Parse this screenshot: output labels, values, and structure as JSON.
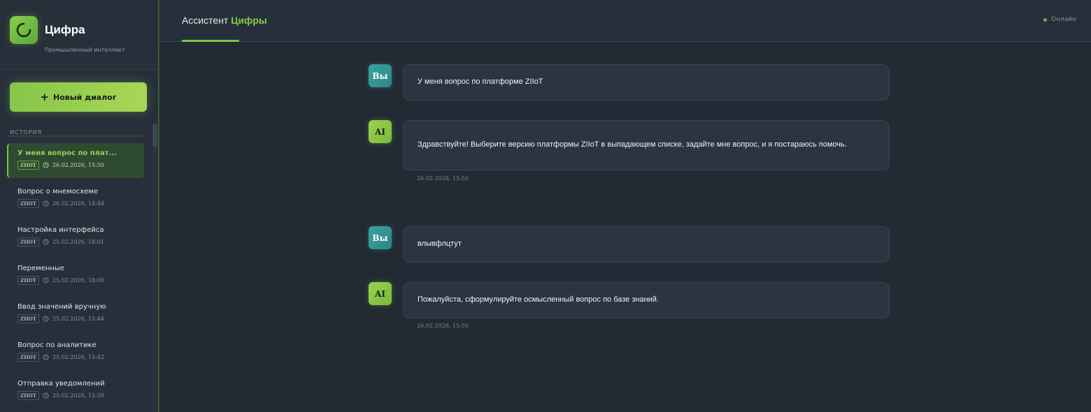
{
  "brand": {
    "name": "Цифра",
    "subtitle": "Промышленный интеллект"
  },
  "sidebar": {
    "new_dialog_label": "Новый диалог",
    "history_label": "История",
    "items": [
      {
        "title": "У меня вопрос по плат...",
        "badge": "ZIIOT",
        "date": "26.02.2026, 15:50",
        "active": true
      },
      {
        "title": "Вопрос о мнемосхеме",
        "badge": "ZIIOT",
        "date": "26.02.2026, 14:44"
      },
      {
        "title": "Настройка интерфейса",
        "badge": "ZIIOT",
        "date": "25.02.2026, 18:01"
      },
      {
        "title": "Переменные",
        "badge": "ZIIOT",
        "date": "25.02.2026, 18:00"
      },
      {
        "title": "Ввод значений вручную",
        "badge": "ZIIOT",
        "date": "25.02.2026, 15:44"
      },
      {
        "title": "Вопрос по аналитике",
        "badge": "ZIIOT",
        "date": "25.02.2026, 15:42"
      },
      {
        "title": "Отправка уведомлений",
        "badge": "ZIIOT",
        "date": "25.02.2026, 15:39"
      }
    ]
  },
  "header": {
    "title_prefix": "Ассистент",
    "title_accent": "Цифры",
    "status": "Онлайн"
  },
  "messages": [
    {
      "role": "user",
      "avatar": "Вы",
      "text": "У меня вопрос по платформе ZIIoT"
    },
    {
      "role": "ai",
      "avatar": "AI",
      "text": "Здравствуйте! Выберите версию платформы ZIIoT в выпадающем списке, задайте мне вопрос, и я постараюсь помочь.",
      "time": "26.02.2026, 15:50"
    },
    {
      "role": "user",
      "avatar": "Вы",
      "text": "влывфлцтут"
    },
    {
      "role": "ai",
      "avatar": "AI",
      "text": "Пожалуйста, сформулируйте осмысленный вопрос по базе знаний.",
      "time": "26.02.2026, 15:50"
    }
  ],
  "colors": {
    "accent": "#7cc24a",
    "user_avatar": "#3aa3a0",
    "background": "#222a33",
    "sidebar": "#27303a"
  },
  "icons": {
    "logo": "cifra-logo-icon",
    "plus": "plus-icon",
    "clock": "clock-icon",
    "status": "status-dot-icon"
  }
}
